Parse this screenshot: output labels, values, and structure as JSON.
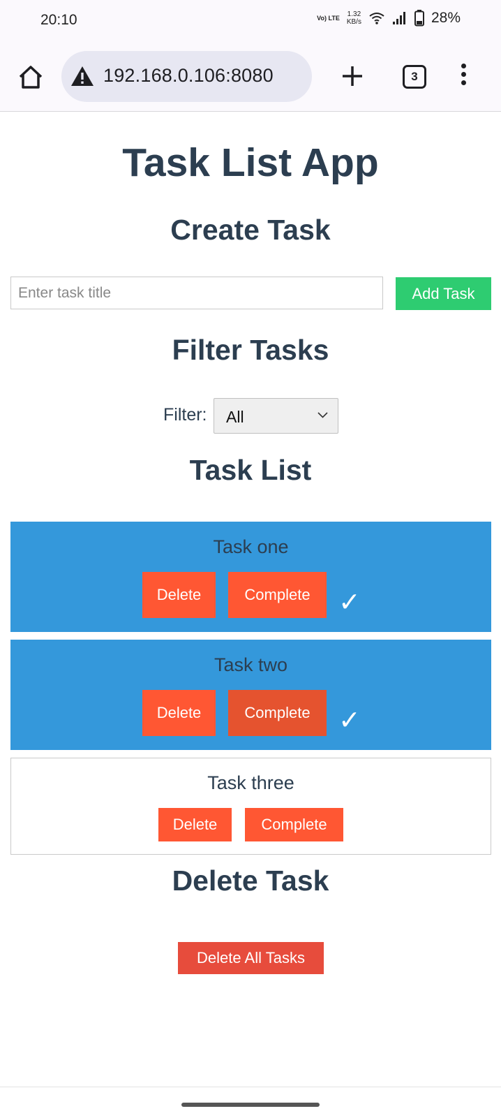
{
  "status_bar": {
    "time": "20:10",
    "network_type": "Vo) LTE",
    "speed_value": "1.32",
    "speed_unit": "KB/s",
    "battery": "28%"
  },
  "browser": {
    "url": "192.168.0.106:8080",
    "tab_count": "3"
  },
  "app": {
    "title": "Task List App",
    "create_heading": "Create Task",
    "input_placeholder": "Enter task title",
    "input_value": "",
    "add_button": "Add Task",
    "filter_heading": "Filter Tasks",
    "filter_label": "Filter:",
    "filter_value": "All",
    "list_heading": "Task List",
    "tasks": [
      {
        "title": "Task one",
        "delete_label": "Delete",
        "complete_label": "Complete",
        "completed": true,
        "checkmark": "✓"
      },
      {
        "title": "Task two",
        "delete_label": "Delete",
        "complete_label": "Complete",
        "completed": true,
        "checkmark": "✓"
      },
      {
        "title": "Task three",
        "delete_label": "Delete",
        "complete_label": "Complete",
        "completed": false
      }
    ],
    "delete_heading": "Delete Task",
    "delete_all_button": "Delete All Tasks"
  },
  "colors": {
    "heading": "#2c3e50",
    "completed_task_bg": "#3498db",
    "add_button": "#2ecc71",
    "action_button": "#ff5733",
    "delete_all_button": "#e74c3c"
  },
  "icons": [
    "home-icon",
    "warning-icon",
    "plus-icon",
    "tabs-icon",
    "more-menu-icon",
    "wifi-icon",
    "signal-icon",
    "battery-icon",
    "chevron-down-icon",
    "checkmark-icon"
  ]
}
